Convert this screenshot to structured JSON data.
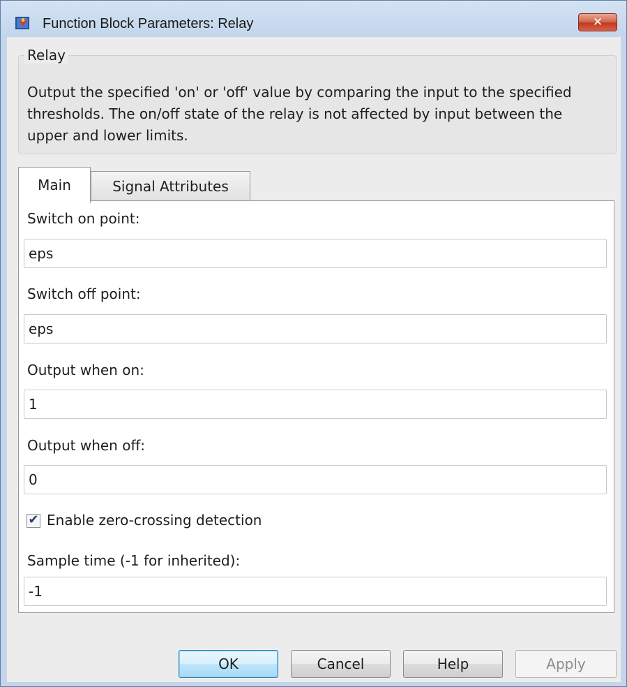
{
  "window": {
    "title": "Function Block Parameters: Relay",
    "close_glyph": "✕",
    "app_icon": "simulink-block-icon",
    "close_color": "#c8412b"
  },
  "description": {
    "group_title": "Relay",
    "text": "Output the specified 'on' or 'off' value by comparing the input to the specified thresholds.  The on/off state of the relay is not affected by input between the upper and lower limits."
  },
  "tabs": [
    {
      "label": "Main",
      "selected": true
    },
    {
      "label": "Signal Attributes",
      "selected": false
    }
  ],
  "fields": [
    {
      "label": "Switch on point:",
      "value": "eps"
    },
    {
      "label": "Switch off point:",
      "value": "eps"
    },
    {
      "label": "Output when on:",
      "value": "1"
    },
    {
      "label": "Output when off:",
      "value": "0"
    }
  ],
  "zero_crossing": {
    "label": "Enable zero-crossing detection",
    "checked": true,
    "glyph": "✔"
  },
  "sample_time": {
    "label": "Sample time (-1 for inherited):",
    "value": "-1"
  },
  "buttons": {
    "ok": "OK",
    "cancel": "Cancel",
    "help": "Help",
    "apply": "Apply"
  }
}
